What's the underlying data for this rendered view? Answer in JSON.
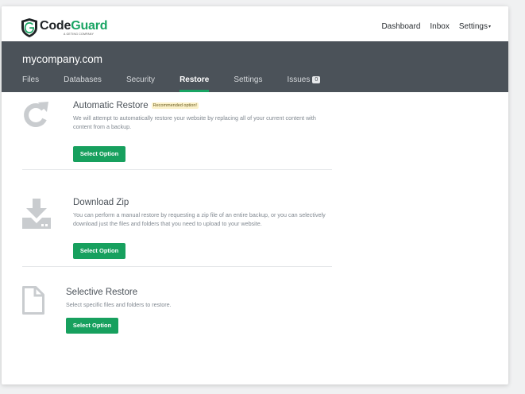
{
  "brand": {
    "name_part1": "Code",
    "name_part2": "Guard",
    "tagline": "A GETING COMPANY",
    "accent_color": "#19a463"
  },
  "topnav": {
    "dashboard": "Dashboard",
    "inbox": "Inbox",
    "settings": "Settings",
    "settings_caret": "▾"
  },
  "site": {
    "title": "mycompany.com"
  },
  "tabs": [
    {
      "label": "Files"
    },
    {
      "label": "Databases"
    },
    {
      "label": "Security"
    },
    {
      "label": "Restore",
      "active": true
    },
    {
      "label": "Settings"
    },
    {
      "label": "Issues",
      "badge": "0"
    }
  ],
  "options": [
    {
      "icon": "refresh-icon",
      "title": "Automatic Restore",
      "tag": "Recommended option!",
      "description": "We will attempt to automatically restore your website by replacing all of your current content with content from a backup.",
      "button": "Select Option"
    },
    {
      "icon": "download-icon",
      "title": "Download Zip",
      "description": "You can perform a manual restore by requesting a zip file of an entire backup, or you can selectively download just the files and folders that you need to upload to your website.",
      "button": "Select Option"
    },
    {
      "icon": "file-icon",
      "title": "Selective Restore",
      "description": "Select specific files and folders to restore.",
      "button": "Select Option"
    }
  ]
}
